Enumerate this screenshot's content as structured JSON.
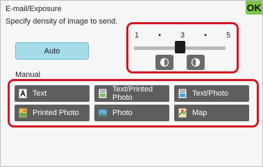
{
  "header": {
    "title": "E-mail/Exposure",
    "subtitle": "Specify density of image to send.",
    "ok_label": "OK"
  },
  "auto": {
    "label": "Auto"
  },
  "manual": {
    "label": "Manual"
  },
  "exposure": {
    "scale": [
      "1",
      "•",
      "3",
      "•",
      "5"
    ],
    "level": 3,
    "lighter_icon": "lighter-half-circle-icon",
    "darker_icon": "darker-half-circle-icon"
  },
  "types": [
    {
      "label": "Text",
      "icon": "text-a-icon"
    },
    {
      "label": "Text/Printed Photo",
      "icon": "text-printed-photo-icon"
    },
    {
      "label": "Text/Photo",
      "icon": "text-photo-icon"
    },
    {
      "label": "Printed Photo",
      "icon": "printed-photo-icon"
    },
    {
      "label": "Photo",
      "icon": "photo-icon"
    },
    {
      "label": "Map",
      "icon": "map-icon"
    }
  ],
  "colors": {
    "highlight": "#d6121f",
    "ok": "#7fc44c",
    "auto": "#a6dbe8",
    "button": "#5e5e5e"
  }
}
